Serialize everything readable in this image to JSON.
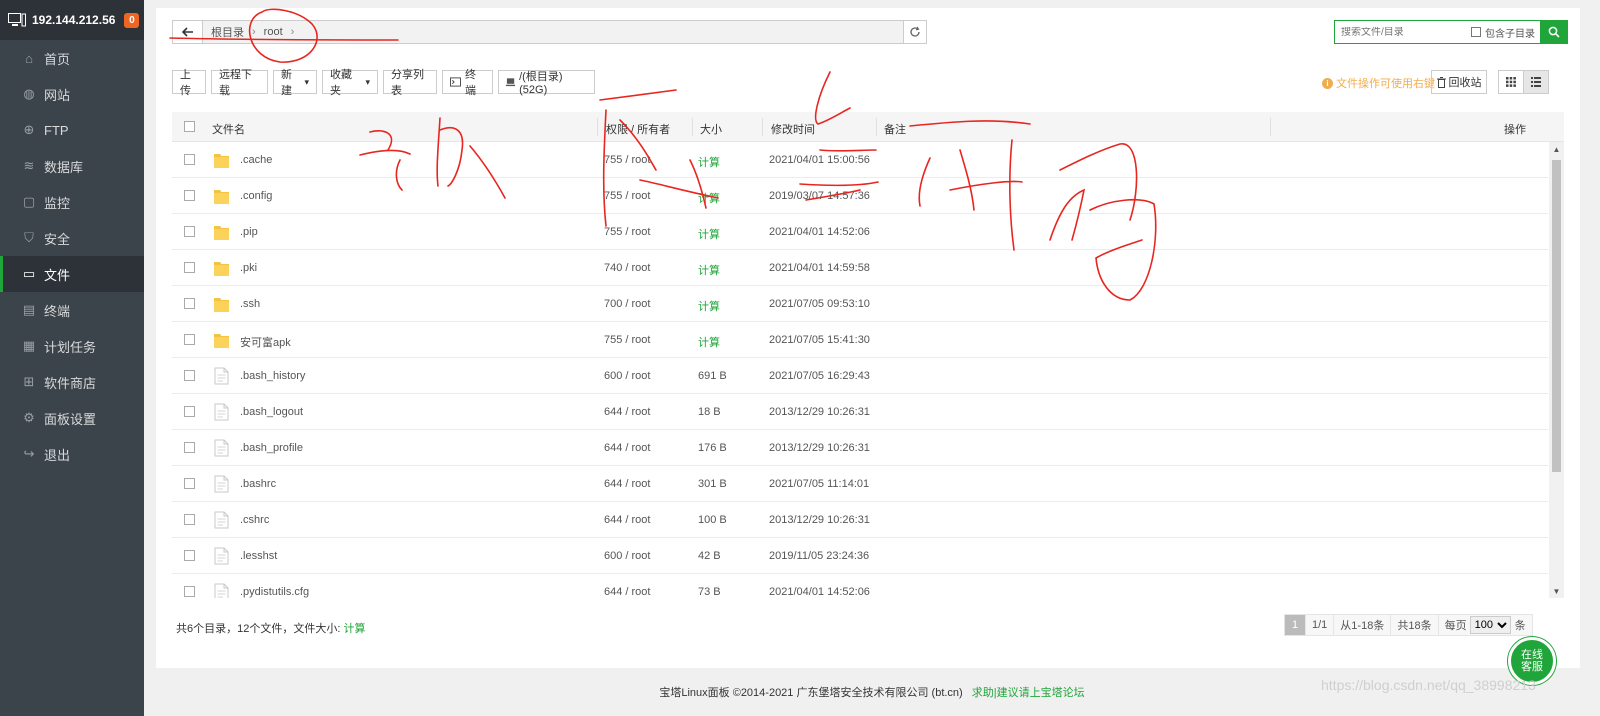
{
  "host": {
    "ip": "192.144.212.56",
    "badge": "0"
  },
  "nav": [
    {
      "label": "首页",
      "icon": "home-icon"
    },
    {
      "label": "网站",
      "icon": "globe-icon"
    },
    {
      "label": "FTP",
      "icon": "ftp-icon"
    },
    {
      "label": "数据库",
      "icon": "database-icon"
    },
    {
      "label": "监控",
      "icon": "monitor-icon"
    },
    {
      "label": "安全",
      "icon": "shield-icon"
    },
    {
      "label": "文件",
      "icon": "folder-icon",
      "active": true
    },
    {
      "label": "终端",
      "icon": "terminal-icon"
    },
    {
      "label": "计划任务",
      "icon": "calendar-icon"
    },
    {
      "label": "软件商店",
      "icon": "apps-icon"
    },
    {
      "label": "面板设置",
      "icon": "gear-icon"
    },
    {
      "label": "退出",
      "icon": "logout-icon"
    }
  ],
  "path": {
    "root": "根目录",
    "current": "root"
  },
  "search": {
    "placeholder": "搜索文件/目录",
    "include_sub": "包含子目录"
  },
  "toolbar": {
    "upload": "上传",
    "remote_download": "远程下载",
    "new": "新建",
    "favorites": "收藏夹",
    "share_list": "分享列表",
    "terminal": "终端",
    "disk": "/(根目录) (52G)"
  },
  "tip": "文件操作可使用右键",
  "recycle": "回收站",
  "columns": {
    "name": "文件名",
    "perm": "权限 / 所有者",
    "size": "大小",
    "mtime": "修改时间",
    "remark": "备注",
    "ops": "操作"
  },
  "files": [
    {
      "name": ".cache",
      "type": "folder",
      "perm": "755 / root",
      "size": "计算",
      "mtime": "2021/04/01 15:00:56"
    },
    {
      "name": ".config",
      "type": "folder",
      "perm": "755 / root",
      "size": "计算",
      "mtime": "2019/03/07 14:57:36"
    },
    {
      "name": ".pip",
      "type": "folder",
      "perm": "755 / root",
      "size": "计算",
      "mtime": "2021/04/01 14:52:06"
    },
    {
      "name": ".pki",
      "type": "folder",
      "perm": "740 / root",
      "size": "计算",
      "mtime": "2021/04/01 14:59:58"
    },
    {
      "name": ".ssh",
      "type": "folder",
      "perm": "700 / root",
      "size": "计算",
      "mtime": "2021/07/05 09:53:10"
    },
    {
      "name": "安可富apk",
      "type": "folder",
      "perm": "755 / root",
      "size": "计算",
      "mtime": "2021/07/05 15:41:30"
    },
    {
      "name": ".bash_history",
      "type": "file",
      "perm": "600 / root",
      "size": "691 B",
      "mtime": "2021/07/05 16:29:43"
    },
    {
      "name": ".bash_logout",
      "type": "file",
      "perm": "644 / root",
      "size": "18 B",
      "mtime": "2013/12/29 10:26:31"
    },
    {
      "name": ".bash_profile",
      "type": "file",
      "perm": "644 / root",
      "size": "176 B",
      "mtime": "2013/12/29 10:26:31"
    },
    {
      "name": ".bashrc",
      "type": "file",
      "perm": "644 / root",
      "size": "301 B",
      "mtime": "2021/07/05 11:14:01"
    },
    {
      "name": ".cshrc",
      "type": "file",
      "perm": "644 / root",
      "size": "100 B",
      "mtime": "2013/12/29 10:26:31"
    },
    {
      "name": ".lesshst",
      "type": "file",
      "perm": "600 / root",
      "size": "42 B",
      "mtime": "2019/11/05 23:24:36"
    },
    {
      "name": ".pydistutils.cfg",
      "type": "file",
      "perm": "644 / root",
      "size": "73 B",
      "mtime": "2021/04/01 14:52:06"
    }
  ],
  "summary": {
    "text": "共6个目录，12个文件，文件大小:",
    "calc": "计算"
  },
  "pager": {
    "current": "1",
    "pages": "1/1",
    "range": "从1-18条",
    "total": "共18条",
    "per_page_label": "每页",
    "per_page": "100",
    "unit": "条"
  },
  "footer": {
    "copyright": "宝塔Linux面板 ©2014-2021 广东堡塔安全技术有限公司 (bt.cn)",
    "forum": "求助|建议请上宝塔论坛"
  },
  "chat": {
    "line1": "在线",
    "line2": "客服"
  },
  "watermark": "https://blog.csdn.net/qq_38998213",
  "colors": {
    "accent": "#20a53a",
    "sidebar": "#3b434b",
    "warning": "#f0ad4e",
    "badge": "#ef6522"
  }
}
